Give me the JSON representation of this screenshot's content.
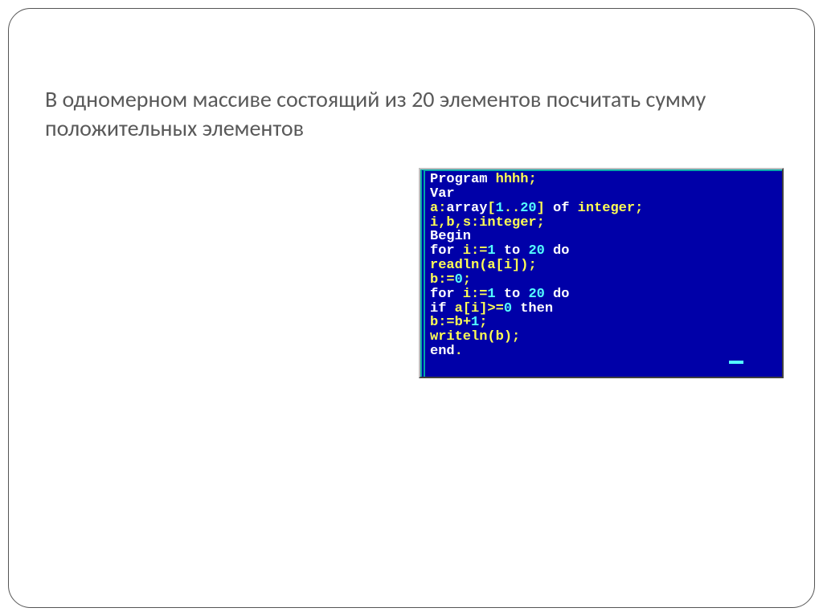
{
  "slide": {
    "title": "В одномерном массиве состоящий из 20 элементов посчитать сумму положительных элементов"
  },
  "code": {
    "l1_kw1": "Program",
    "l1_name": " hhhh",
    "l1_semi": ";",
    "l2_kw": "Var",
    "l3_a": "a",
    "l3_colon": ":",
    "l3_arr": "array",
    "l3_br1": "[",
    "l3_n1": "1",
    "l3_dots": "..",
    "l3_n2": "20",
    "l3_br2": "] ",
    "l3_of": "of",
    "l3_int": " integer",
    "l3_semi": ";",
    "l4_ids": "i",
    "l4_c1": ",",
    "l4_b": "b",
    "l4_c2": ",",
    "l4_s": "s",
    "l4_colon": ":",
    "l4_int": "integer",
    "l4_semi": ";",
    "l5_begin": "Begin",
    "l6_for": "for",
    "l6_i": " i",
    "l6_assign": ":=",
    "l6_n1": "1",
    "l6_to": " to ",
    "l6_n2": "20",
    "l6_do": " do",
    "l7_read": "readln",
    "l7_p1": "(",
    "l7_a": "a",
    "l7_br1": "[",
    "l7_i": "i",
    "l7_br2": "]",
    "l7_p2": ")",
    "l7_semi": ";",
    "l8_b": "b",
    "l8_assign": ":=",
    "l8_n": "0",
    "l8_semi": ";",
    "l9_for": "for",
    "l9_i": " i",
    "l9_assign": ":=",
    "l9_n1": "1",
    "l9_to": " to ",
    "l9_n2": "20",
    "l9_do": " do",
    "l10_if": "if",
    "l10_a": " a",
    "l10_br1": "[",
    "l10_i": "i",
    "l10_br2": "]",
    "l10_op": ">=",
    "l10_n": "0",
    "l10_then": " then",
    "l11_b": "b",
    "l11_assign": ":=",
    "l11_b2": "b",
    "l11_plus": "+",
    "l11_n": "1",
    "l11_semi": ";",
    "l12_write": "writeln",
    "l12_p1": "(",
    "l12_b": "b",
    "l12_p2": ")",
    "l12_semi": ";",
    "l13_end": "end",
    "l13_dot": "."
  }
}
